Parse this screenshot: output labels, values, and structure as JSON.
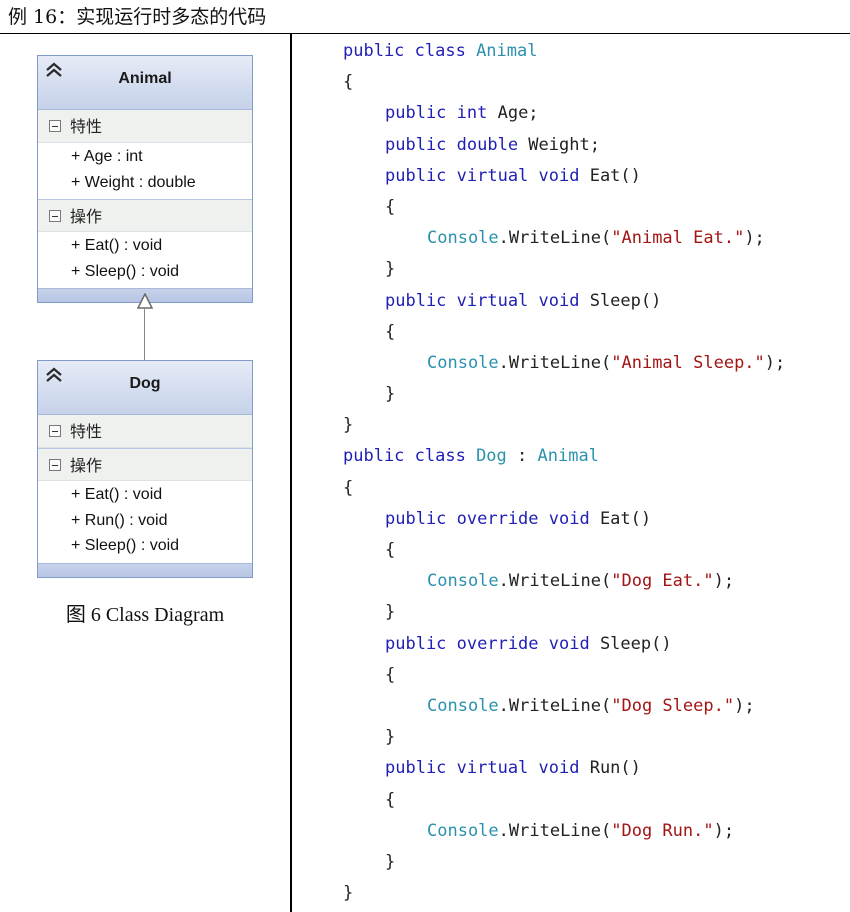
{
  "header": {
    "title": "例 16：实现运行时多态的代码"
  },
  "diagram": {
    "caption": "图 6 Class Diagram",
    "classes": [
      {
        "name": "Animal",
        "sections": [
          {
            "label": "特性",
            "members": [
              "+ Age : int",
              "+ Weight : double"
            ]
          },
          {
            "label": "操作",
            "members": [
              "+ Eat() : void",
              "+ Sleep() : void"
            ]
          }
        ]
      },
      {
        "name": "Dog",
        "sections": [
          {
            "label": "特性",
            "members": []
          },
          {
            "label": "操作",
            "members": [
              "+ Eat() : void",
              "+ Run() : void",
              "+ Sleep() : void"
            ]
          }
        ]
      }
    ]
  },
  "code": {
    "lines": [
      {
        "indent": 0,
        "tokens": [
          [
            "kw",
            "public class "
          ],
          [
            "ty",
            "Animal"
          ]
        ]
      },
      {
        "indent": 0,
        "tokens": [
          [
            "pn",
            "{"
          ]
        ]
      },
      {
        "indent": 1,
        "tokens": [
          [
            "kw",
            "public int "
          ],
          [
            "pn",
            "Age;"
          ]
        ]
      },
      {
        "indent": 1,
        "tokens": [
          [
            "kw",
            "public double "
          ],
          [
            "pn",
            "Weight;"
          ]
        ]
      },
      {
        "indent": 1,
        "tokens": [
          [
            "kw",
            "public virtual void "
          ],
          [
            "pn",
            "Eat()"
          ]
        ]
      },
      {
        "indent": 1,
        "tokens": [
          [
            "pn",
            "{"
          ]
        ]
      },
      {
        "indent": 2,
        "tokens": [
          [
            "ty",
            "Console"
          ],
          [
            "pn",
            ".WriteLine("
          ],
          [
            "str",
            "\"Animal Eat.\""
          ],
          [
            "pn",
            ");"
          ]
        ]
      },
      {
        "indent": 1,
        "tokens": [
          [
            "pn",
            "}"
          ]
        ]
      },
      {
        "indent": 1,
        "tokens": [
          [
            "kw",
            "public virtual void "
          ],
          [
            "pn",
            "Sleep()"
          ]
        ]
      },
      {
        "indent": 1,
        "tokens": [
          [
            "pn",
            "{"
          ]
        ]
      },
      {
        "indent": 2,
        "tokens": [
          [
            "ty",
            "Console"
          ],
          [
            "pn",
            ".WriteLine("
          ],
          [
            "str",
            "\"Animal Sleep.\""
          ],
          [
            "pn",
            ");"
          ]
        ]
      },
      {
        "indent": 1,
        "tokens": [
          [
            "pn",
            "}"
          ]
        ]
      },
      {
        "indent": 0,
        "tokens": [
          [
            "pn",
            "}"
          ]
        ]
      },
      {
        "indent": 0,
        "tokens": [
          [
            "kw",
            "public class "
          ],
          [
            "ty",
            "Dog"
          ],
          [
            "pn",
            " : "
          ],
          [
            "ty",
            "Animal"
          ]
        ]
      },
      {
        "indent": 0,
        "tokens": [
          [
            "pn",
            "{"
          ]
        ]
      },
      {
        "indent": 1,
        "tokens": [
          [
            "kw",
            "public override void "
          ],
          [
            "pn",
            "Eat()"
          ]
        ]
      },
      {
        "indent": 1,
        "tokens": [
          [
            "pn",
            "{"
          ]
        ]
      },
      {
        "indent": 2,
        "tokens": [
          [
            "ty",
            "Console"
          ],
          [
            "pn",
            ".WriteLine("
          ],
          [
            "str",
            "\"Dog Eat.\""
          ],
          [
            "pn",
            ");"
          ]
        ]
      },
      {
        "indent": 1,
        "tokens": [
          [
            "pn",
            "}"
          ]
        ]
      },
      {
        "indent": 1,
        "tokens": [
          [
            "kw",
            "public override void "
          ],
          [
            "pn",
            "Sleep()"
          ]
        ]
      },
      {
        "indent": 1,
        "tokens": [
          [
            "pn",
            "{"
          ]
        ]
      },
      {
        "indent": 2,
        "tokens": [
          [
            "ty",
            "Console"
          ],
          [
            "pn",
            ".WriteLine("
          ],
          [
            "str",
            "\"Dog Sleep.\""
          ],
          [
            "pn",
            ");"
          ]
        ]
      },
      {
        "indent": 1,
        "tokens": [
          [
            "pn",
            "}"
          ]
        ]
      },
      {
        "indent": 1,
        "tokens": [
          [
            "kw",
            "public virtual void "
          ],
          [
            "pn",
            "Run()"
          ]
        ]
      },
      {
        "indent": 1,
        "tokens": [
          [
            "pn",
            "{"
          ]
        ]
      },
      {
        "indent": 2,
        "tokens": [
          [
            "ty",
            "Console"
          ],
          [
            "pn",
            ".WriteLine("
          ],
          [
            "str",
            "\"Dog Run.\""
          ],
          [
            "pn",
            ");"
          ]
        ]
      },
      {
        "indent": 1,
        "tokens": [
          [
            "pn",
            "}"
          ]
        ]
      },
      {
        "indent": 0,
        "tokens": [
          [
            "pn",
            "}"
          ]
        ]
      }
    ]
  }
}
